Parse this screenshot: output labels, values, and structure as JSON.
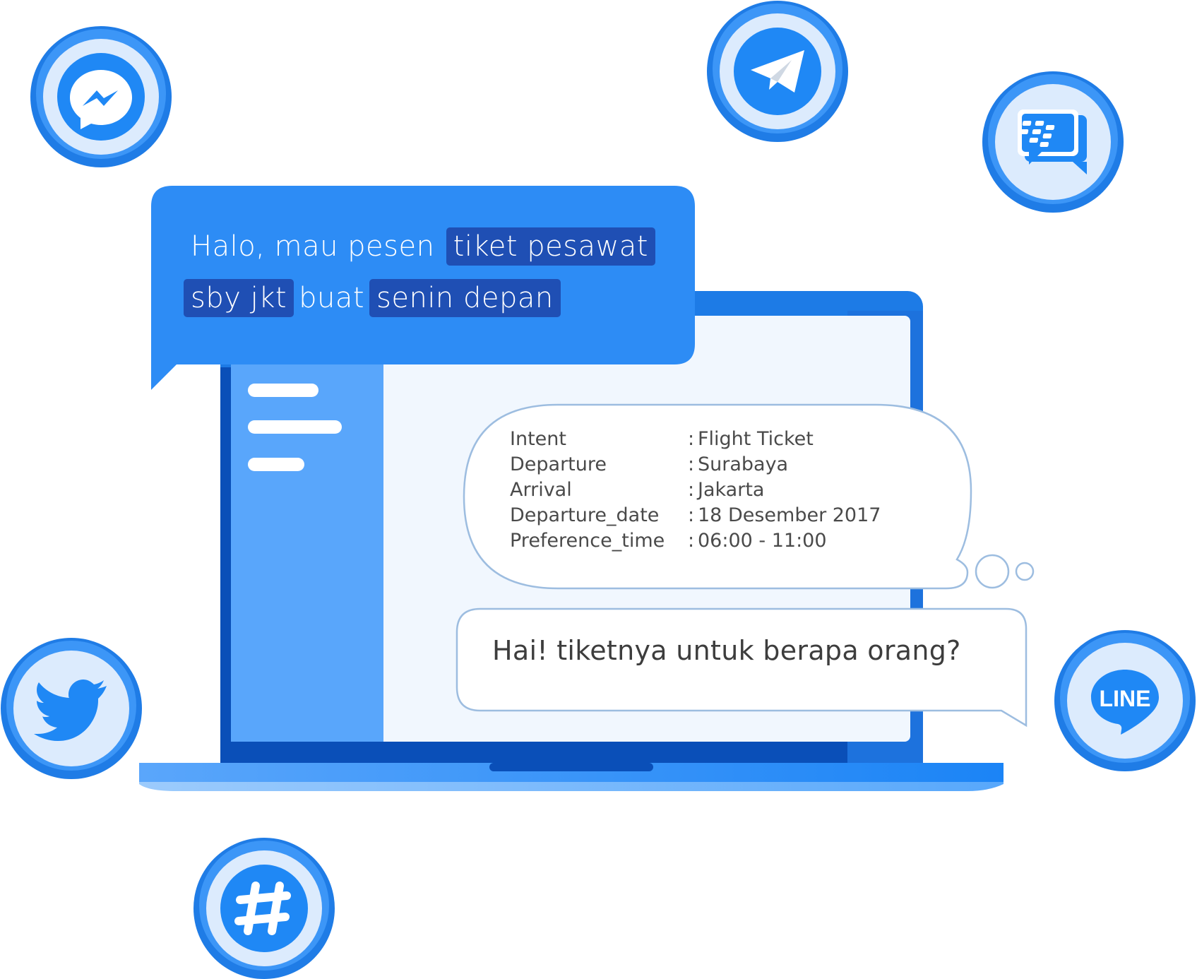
{
  "colors": {
    "primary": "#2d8cf5",
    "dark": "#0a4fb8",
    "highlight": "#1f4fb4",
    "panel": "#59a6fb",
    "screen": "#f1f7fe",
    "bubble_border": "#9dbde0"
  },
  "user_message": {
    "line1_plain": "Halo, mau pesen",
    "line1_entity": "tiket pesawat",
    "line2_entity1": "sby jkt",
    "line2_plain": "buat",
    "line2_entity2": "senin depan"
  },
  "nlu": {
    "rows": [
      {
        "key": "Intent",
        "value": "Flight Ticket"
      },
      {
        "key": "Departure",
        "value": "Surabaya"
      },
      {
        "key": "Arrival",
        "value": "Jakarta"
      },
      {
        "key": "Departure_date",
        "value": "18 Desember 2017"
      },
      {
        "key": "Preference_time",
        "value": "06:00 - 11:00"
      }
    ]
  },
  "bot_reply": "Hai! tiketnya untuk berapa orang?",
  "icons": {
    "messenger": "messenger-icon",
    "telegram": "telegram-icon",
    "bbm": "bbm-icon",
    "twitter": "twitter-icon",
    "line": "line-icon",
    "slack": "slack-icon",
    "line_text": "LINE"
  }
}
